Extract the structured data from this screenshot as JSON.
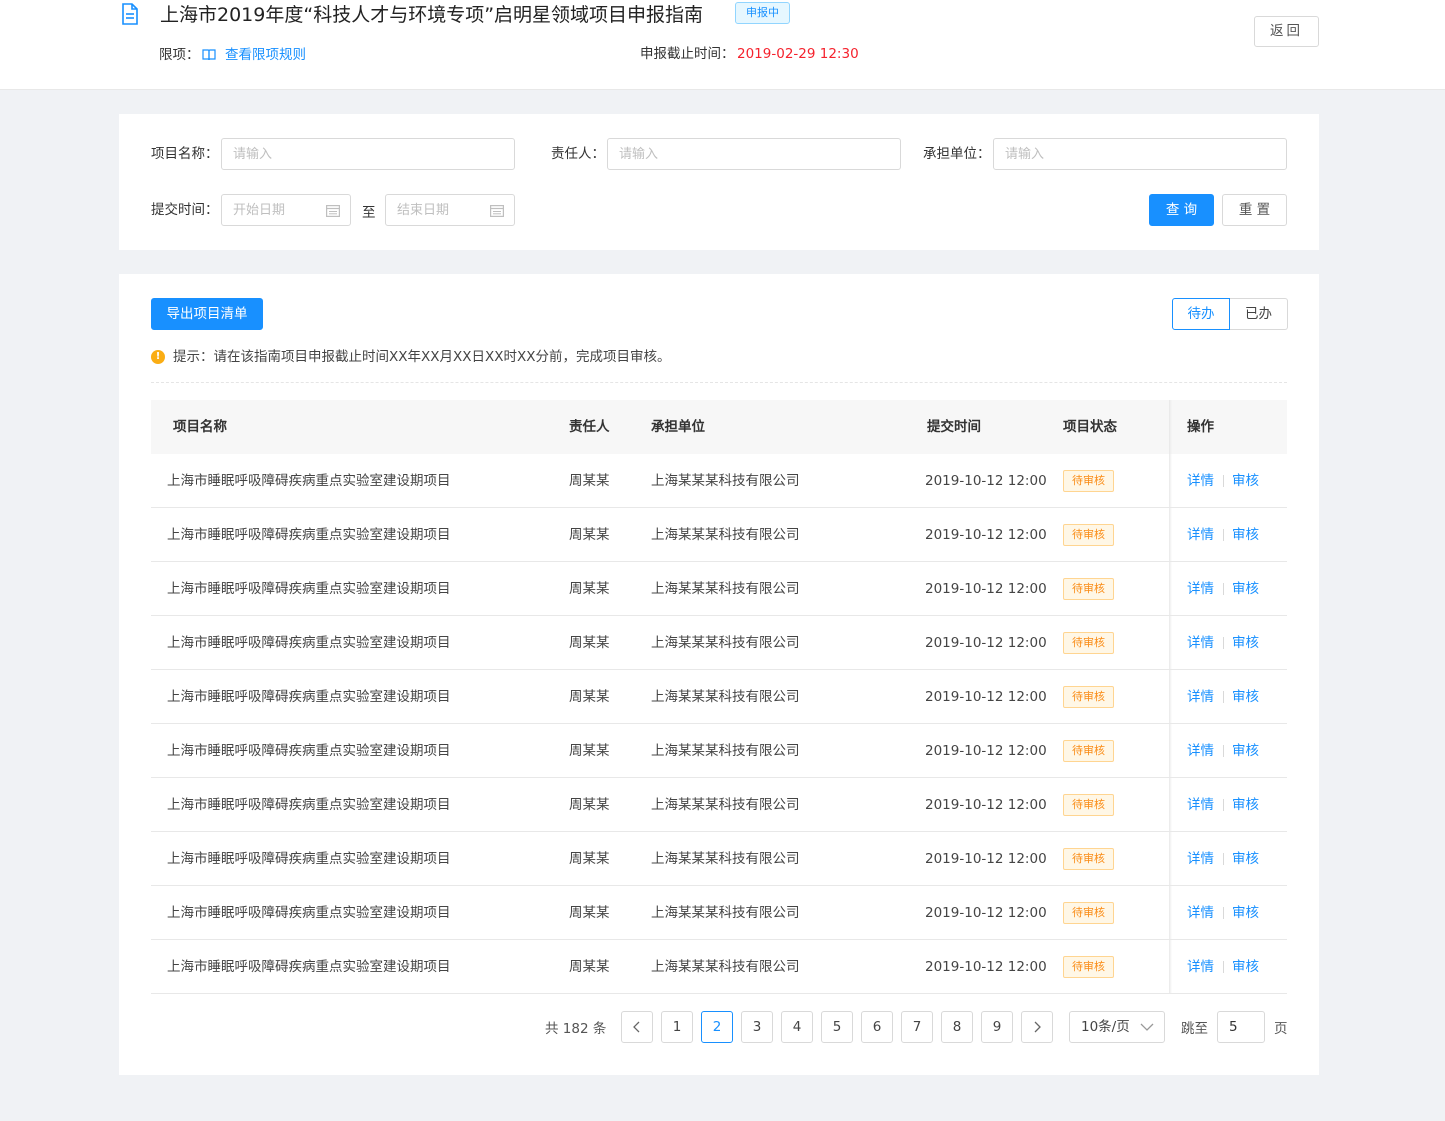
{
  "header": {
    "title": "上海市2019年度“科技人才与环境专项”启明星领域项目申报指南",
    "status_tag": "申报中",
    "limit_label": "限项：",
    "limit_link": "查看限项规则",
    "deadline_label": "申报截止时间：",
    "deadline_value": "2019-02-29 12:30",
    "back_label": "返回"
  },
  "filters": {
    "project_name_label": "项目名称：",
    "project_name_placeholder": "请输入",
    "owner_label": "责任人：",
    "owner_placeholder": "请输入",
    "unit_label": "承担单位：",
    "unit_placeholder": "请输入",
    "submit_time_label": "提交时间：",
    "start_placeholder": "开始日期",
    "to_label": "至",
    "end_placeholder": "结束日期",
    "query_label": "查 询",
    "reset_label": "重 置"
  },
  "toolbar": {
    "export_label": "导出项目清单",
    "tabs": [
      "待办",
      "已办"
    ],
    "active_tab": "待办"
  },
  "tip": {
    "icon": "!",
    "text": "提示：请在该指南项目申报截止时间XX年XX月XX日XX时XX分前，完成项目审核。"
  },
  "table": {
    "columns": [
      "项目名称",
      "责任人",
      "承担单位",
      "提交时间",
      "项目状态",
      "操作"
    ],
    "rows": [
      {
        "name": "上海市睡眠呼吸障碍疾病重点实验室建设期项目",
        "owner": "周某某",
        "unit": "上海某某某科技有限公司",
        "time": "2019-10-12 12:00",
        "status": "待审核",
        "op1": "详情",
        "op2": "审核"
      },
      {
        "name": "上海市睡眠呼吸障碍疾病重点实验室建设期项目",
        "owner": "周某某",
        "unit": "上海某某某科技有限公司",
        "time": "2019-10-12 12:00",
        "status": "待审核",
        "op1": "详情",
        "op2": "审核"
      },
      {
        "name": "上海市睡眠呼吸障碍疾病重点实验室建设期项目",
        "owner": "周某某",
        "unit": "上海某某某科技有限公司",
        "time": "2019-10-12 12:00",
        "status": "待审核",
        "op1": "详情",
        "op2": "审核"
      },
      {
        "name": "上海市睡眠呼吸障碍疾病重点实验室建设期项目",
        "owner": "周某某",
        "unit": "上海某某某科技有限公司",
        "time": "2019-10-12 12:00",
        "status": "待审核",
        "op1": "详情",
        "op2": "审核"
      },
      {
        "name": "上海市睡眠呼吸障碍疾病重点实验室建设期项目",
        "owner": "周某某",
        "unit": "上海某某某科技有限公司",
        "time": "2019-10-12 12:00",
        "status": "待审核",
        "op1": "详情",
        "op2": "审核"
      },
      {
        "name": "上海市睡眠呼吸障碍疾病重点实验室建设期项目",
        "owner": "周某某",
        "unit": "上海某某某科技有限公司",
        "time": "2019-10-12 12:00",
        "status": "待审核",
        "op1": "详情",
        "op2": "审核"
      },
      {
        "name": "上海市睡眠呼吸障碍疾病重点实验室建设期项目",
        "owner": "周某某",
        "unit": "上海某某某科技有限公司",
        "time": "2019-10-12 12:00",
        "status": "待审核",
        "op1": "详情",
        "op2": "审核"
      },
      {
        "name": "上海市睡眠呼吸障碍疾病重点实验室建设期项目",
        "owner": "周某某",
        "unit": "上海某某某科技有限公司",
        "time": "2019-10-12 12:00",
        "status": "待审核",
        "op1": "详情",
        "op2": "审核"
      },
      {
        "name": "上海市睡眠呼吸障碍疾病重点实验室建设期项目",
        "owner": "周某某",
        "unit": "上海某某某科技有限公司",
        "time": "2019-10-12 12:00",
        "status": "待审核",
        "op1": "详情",
        "op2": "审核"
      },
      {
        "name": "上海市睡眠呼吸障碍疾病重点实验室建设期项目",
        "owner": "周某某",
        "unit": "上海某某某科技有限公司",
        "time": "2019-10-12 12:00",
        "status": "待审核",
        "op1": "详情",
        "op2": "审核"
      }
    ]
  },
  "pagination": {
    "total_text": "共 182 条",
    "pages": [
      "1",
      "2",
      "3",
      "4",
      "5",
      "6",
      "7",
      "8",
      "9"
    ],
    "current": "2",
    "page_size": "10条/页",
    "jump_label": "跳至",
    "jump_value": "5",
    "page_unit": "页"
  },
  "colors": {
    "primary": "#1890ff",
    "deadline": "#f5222d",
    "pending": "#fa8c16",
    "tip": "#faad14"
  }
}
